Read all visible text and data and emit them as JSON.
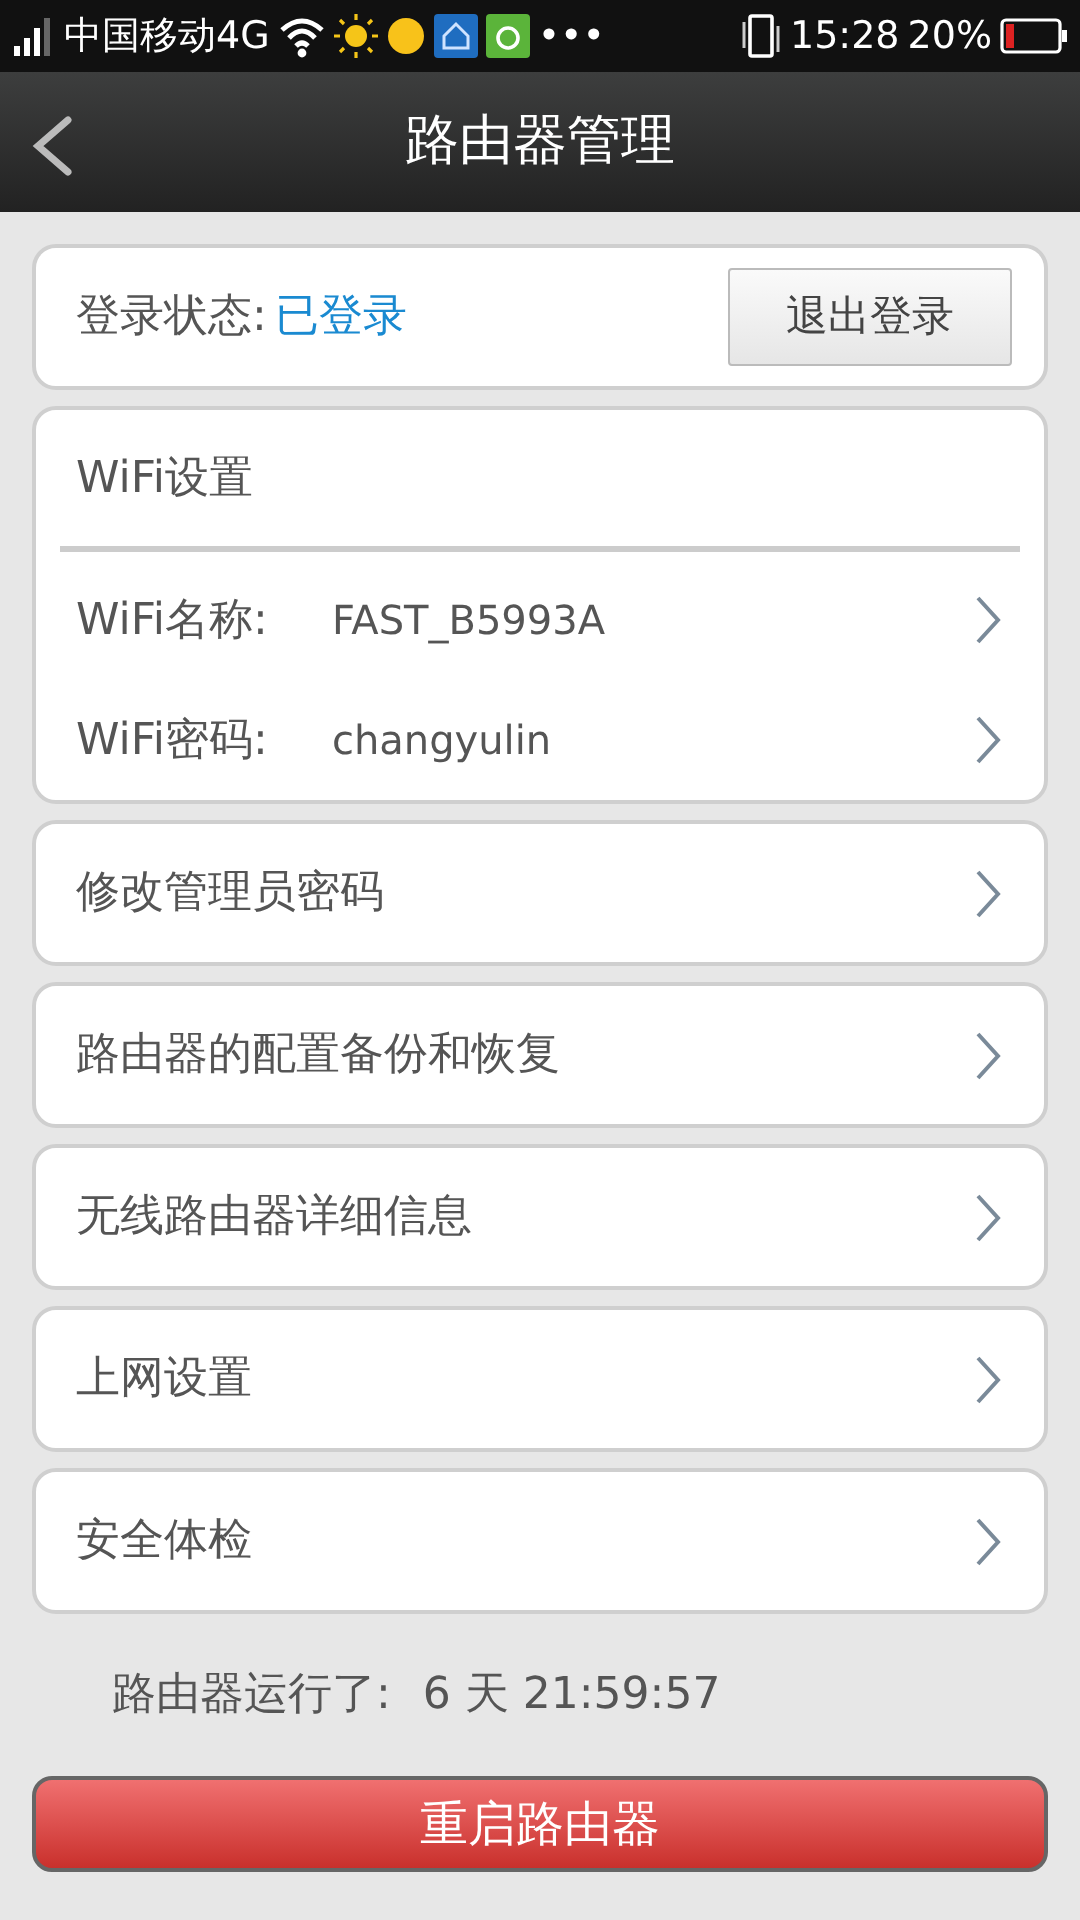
{
  "status_bar": {
    "carrier": "中国移动4G",
    "more": "•••",
    "time": "15:28",
    "battery": "20%"
  },
  "header": {
    "title": "路由器管理"
  },
  "login": {
    "label": "登录状态:",
    "value": "已登录",
    "button": "退出登录"
  },
  "wifi": {
    "title": "WiFi设置",
    "rows": [
      {
        "label": "WiFi名称:",
        "value": "FAST_B5993A"
      },
      {
        "label": "WiFi密码:",
        "value": "changyulin"
      }
    ]
  },
  "menu": [
    {
      "label": "修改管理员密码"
    },
    {
      "label": "路由器的配置备份和恢复"
    },
    {
      "label": "无线路由器详细信息"
    },
    {
      "label": "上网设置"
    },
    {
      "label": "安全体检"
    }
  ],
  "uptime": {
    "label": "路由器运行了:",
    "value": "6 天 21:59:57"
  },
  "restart_button": "重启路由器"
}
